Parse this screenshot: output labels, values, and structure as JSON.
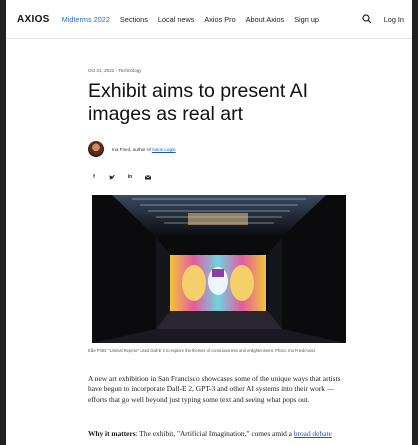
{
  "nav": {
    "logo": "AXIOS",
    "links": [
      "Midterms 2022",
      "Sections",
      "Local news",
      "Axios Pro",
      "About Axios",
      "Sign up"
    ],
    "login": "Log In"
  },
  "article": {
    "date": "Oct 31, 2022 - Technology",
    "headline_line1": "Exhibit aims to present AI",
    "headline_line2": "images as real art",
    "byline_prefix": "Ina Fried, author of",
    "byline_link": "Axios Login",
    "share_icons": [
      "f",
      "twitter",
      "in",
      "mail"
    ],
    "caption": "Ellie Pritts' \"Liminal Reprise\" used Dall-E 2 to explore the themes of consciousness and enlightenment. Photo: Ina Fried/Axios",
    "para1": "A new art exhibition in San Francisco showcases some of the unique ways that artists have begun to incorporate Dall-E 2, GPT-3 and other AI systems into their work — efforts that go well beyond just typing some text and seeing what pops out.",
    "para2_bold": "Why it matters",
    "para2_text": ": The exhibit, \"Artificial Imagination,\" comes amid a ",
    "para2_link": "broad debate"
  },
  "colors": {
    "accent": "#2a6fd6",
    "link": "#1a55c4"
  }
}
